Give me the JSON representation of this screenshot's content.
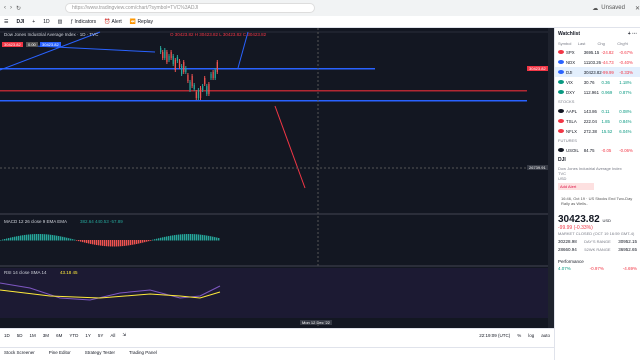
{
  "browser": {
    "url": "https://www.tradingview.com/chart/?symbol=TVC%3ADJI",
    "tab_title": "DJI",
    "profile_label": "Unsaved"
  },
  "toolbar": {
    "symbol": "DJI",
    "interval": "1D",
    "indicators": "Indicators",
    "alert": "Alert",
    "replay": "Replay"
  },
  "chart": {
    "legend": "Dow Jones Industrial Average Index · 1D · TVC",
    "ohlc": "O 30423.82 H 30423.82 L 30423.82 C 30423.82",
    "price_left_a": "30423.82",
    "price_left_b": "0.00",
    "price_left_c": "30423.82",
    "price_tag_a": "30423.82",
    "price_tag_b": "30423.82",
    "price_crosshair": "26739.91",
    "macd_legend": "MACD 12 26 close 9 EMA EMA",
    "macd_values": "382.64 440.53 -57.89",
    "rsi_legend": "RSI 14 close SMA 14",
    "rsi_values": "43.18 45",
    "x_axis_date": "Mon 12 Dec '22"
  },
  "timeframes": [
    "1D",
    "5D",
    "1M",
    "3M",
    "6M",
    "YTD",
    "1Y",
    "5Y",
    "All"
  ],
  "bottom_right": {
    "time": "22:19:09 (UTC)",
    "pct": "%",
    "log": "log",
    "auto": "auto"
  },
  "bottom_tabs": [
    "Stock Screener",
    "Pine Editor",
    "Strategy Tester",
    "Trading Panel"
  ],
  "watchlist": {
    "title": "Watchlist",
    "cols": [
      "Symbol",
      "Last",
      "Chg",
      "Chg%"
    ],
    "rows": [
      {
        "sym": "SPX",
        "last": "3695.15",
        "chg": "-24.82",
        "pct": "-0.67%",
        "color": "#f23645",
        "dir": "neg"
      },
      {
        "sym": "NDX",
        "last": "11103.26",
        "chg": "-44.73",
        "pct": "-0.40%",
        "color": "#2962ff",
        "dir": "neg"
      },
      {
        "sym": "DJI",
        "last": "30423.82",
        "chg": "-99.99",
        "pct": "-0.33%",
        "color": "#2962ff",
        "dir": "neg",
        "sel": true
      },
      {
        "sym": "VIX",
        "last": "30.76",
        "chg": "0.36",
        "pct": "1.18%",
        "color": "#089981",
        "dir": "pos"
      },
      {
        "sym": "DXY",
        "last": "112.961",
        "chg": "0.969",
        "pct": "0.87%",
        "color": "#089981",
        "dir": "pos"
      }
    ],
    "stocks_label": "STOCKS",
    "stocks": [
      {
        "sym": "AAPL",
        "last": "143.86",
        "chg": "0.11",
        "pct": "0.08%",
        "color": "#131722",
        "dir": "pos"
      },
      {
        "sym": "TSLA",
        "last": "222.04",
        "chg": "1.85",
        "pct": "0.84%",
        "color": "#f23645",
        "dir": "pos"
      },
      {
        "sym": "NFLX",
        "last": "272.38",
        "chg": "15.52",
        "pct": "6.04%",
        "color": "#f23645",
        "dir": "pos"
      }
    ],
    "futures_label": "FUTURES",
    "futures": [
      {
        "sym": "USOIL",
        "last": "84.75",
        "chg": "-0.05",
        "pct": "-0.06%",
        "color": "#131722",
        "dir": "neg"
      }
    ]
  },
  "detail": {
    "ticker": "DJI",
    "name": "Dow Jones Industrial Average Index",
    "exchange": "TVC",
    "sector": "USD",
    "add_alert": "Add Alert",
    "news": "16:46, Oct 19 · US Stocks End Two-Day Rally as Wells..",
    "price": "30423.82",
    "price_unit": "USD",
    "change": "-99.99 (-0.33%)",
    "market": "MARKET CLOSED (OCT 19 16:59 GMT-4)",
    "range_low": "30228.98",
    "range_high": "30952.15",
    "range2_low": "28660.94",
    "range2_high": "36952.65",
    "range_label": "DAY'S RANGE",
    "range2_label": "52WK RANGE",
    "performance_label": "Performance",
    "perf": [
      "4.07%",
      "-0.97%",
      "-4.69%"
    ]
  }
}
